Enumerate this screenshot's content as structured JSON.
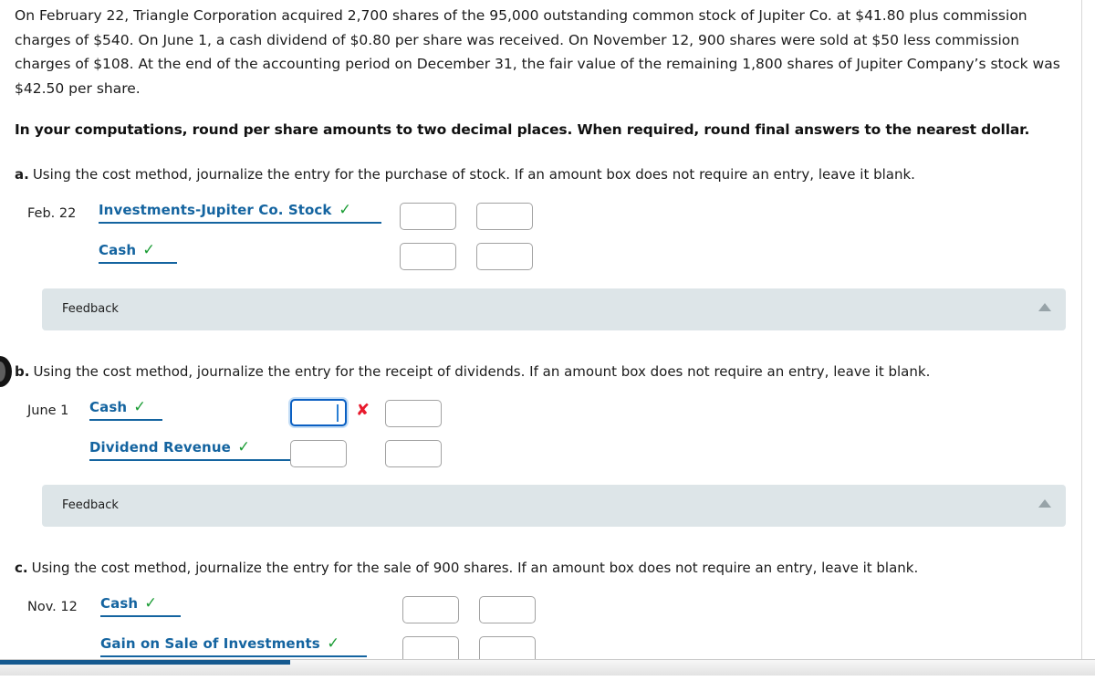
{
  "problem": {
    "intro": "On February 22, Triangle Corporation acquired 2,700 shares of the 95,000 outstanding common stock of Jupiter Co. at $41.80 plus commission charges of $540. On June 1, a cash dividend of $0.80 per share was received. On November 12, 900 shares were sold at $50 less commission charges of $108. At the end of the accounting period on December 31, the fair value of the remaining 1,800 shares of Jupiter Company’s stock was $42.50 per share.",
    "rounding_note": "In your computations, round per share amounts to two decimal places. When required, round final answers to the nearest dollar."
  },
  "parts": [
    {
      "letter": "a.",
      "prompt": "Using the cost method, journalize the entry for the purchase of stock. If an amount box does not require an entry, leave it blank.",
      "rows": [
        {
          "date": "Feb. 22",
          "account": "Investments-Jupiter Co. Stock",
          "status": "correct",
          "debit": "",
          "credit": "",
          "debit_focused": false,
          "error_mark": ""
        },
        {
          "date": "",
          "account": "Cash",
          "status": "correct",
          "debit": "",
          "credit": "",
          "debit_focused": false,
          "error_mark": ""
        }
      ],
      "feedback_label": "Feedback"
    },
    {
      "letter": "b.",
      "prompt": "Using the cost method, journalize the entry for the receipt of dividends. If an amount box does not require an entry, leave it blank.",
      "rows": [
        {
          "date": "June 1",
          "account": "Cash",
          "status": "correct",
          "debit": "",
          "credit": "",
          "debit_focused": true,
          "error_mark": "✘"
        },
        {
          "date": "",
          "account": "Dividend Revenue",
          "status": "correct",
          "debit": "",
          "credit": "",
          "debit_focused": false,
          "error_mark": ""
        }
      ],
      "feedback_label": "Feedback"
    },
    {
      "letter": "c.",
      "prompt": "Using the cost method, journalize the entry for the sale of 900 shares. If an amount box does not require an entry, leave it blank.",
      "rows": [
        {
          "date": "Nov. 12",
          "account": "Cash",
          "status": "correct",
          "debit": "",
          "credit": "",
          "debit_focused": false,
          "error_mark": ""
        },
        {
          "date": "",
          "account": "Gain on Sale of Investments",
          "status": "correct",
          "debit": "",
          "credit": "",
          "debit_focused": false,
          "error_mark": ""
        }
      ],
      "feedback_label": ""
    }
  ],
  "icons": {
    "correct_check": "✓",
    "incorrect_x": "✘",
    "collapse_caret": "collapse-caret-icon"
  },
  "colors": {
    "account_link": "#1464a0",
    "check_green": "#1a9c34",
    "error_red": "#e8192c",
    "feedback_bg": "#dde5e8",
    "focus_blue": "#0a5fc2",
    "scrollbar_thumb": "#15598f"
  }
}
